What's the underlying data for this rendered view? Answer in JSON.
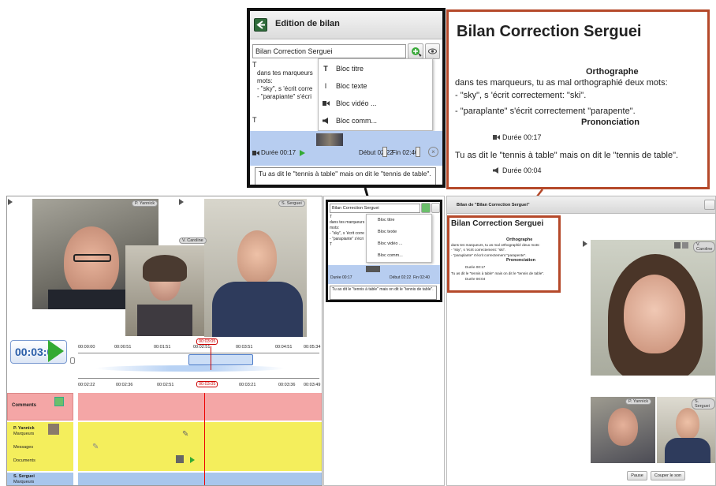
{
  "editor_zoom": {
    "header_title": "Edition de bilan",
    "title_input_value": "Bilan Correction Serguei",
    "menu_items": [
      {
        "icon": "T",
        "label": "Bloc titre"
      },
      {
        "icon": "I",
        "label": "Bloc texte"
      },
      {
        "icon": "video-icon",
        "label": "Bloc vidéo ..."
      },
      {
        "icon": "speaker-icon",
        "label": "Bloc comm..."
      }
    ],
    "block_T1": "T",
    "text_block_lines": [
      "dans tes marqueurs",
      "mots:",
      "- \"sky\", s 'écrit corre",
      "- \"parapiante\" s'écri"
    ],
    "block_T2": "T",
    "duration_label": "Durée 00:17",
    "debut_label": "Début 02:22",
    "fin_label": "Fin 02:40",
    "comment_text": "Tu as dit le \"tennis à table\" mais on dit le \"tennis de table\"."
  },
  "report_zoom": {
    "title": "Bilan Correction Serguei",
    "heading_ortho": "Orthographe",
    "line1": "dans tes marqueurs, tu as mal orthographié deux mots:",
    "line2": "- \"sky\", s 'écrit correctement: \"ski\".",
    "line3": "- \"paraplante\" s'écrit correctement \"parapente\".",
    "heading_prono": "Prononciation",
    "duration1": "Durée 00:17",
    "line4": "Tu as dit le \"tennis à table\" mais on dit le \"tennis de table\".",
    "duration2": "Durée 00:04"
  },
  "left_app": {
    "participants": {
      "p1": "P. Yannick",
      "p2": "S. Serguei",
      "p3": "V. Caroline"
    },
    "timer": "00:03:05",
    "timeline1_ticks": [
      "00:00:00",
      "00:00:51",
      "00:01:51",
      "00:02:51",
      "00:03:51",
      "00:04:51",
      "00:05:34"
    ],
    "timeline1_marker": "00:03:05",
    "timeline2_ticks": [
      "00:02:22",
      "00:02:36",
      "00:02:51",
      "00:03:05",
      "00:03:21",
      "00:03:36",
      "00:03:49"
    ],
    "timeline2_marker": "00:03:05",
    "comments_label": "Comments",
    "track1": {
      "name": "P. Yannick",
      "marqueurs": "Marqueurs",
      "messages": "Messages",
      "documents": "Documents"
    },
    "track2": {
      "name": "S. Serguei",
      "marqueurs": "Marqueurs"
    }
  },
  "mid_small": {
    "title_input_value": "Bilan Correction Serguei",
    "menu_items": [
      "Bloc titre",
      "Bloc texte",
      "Bloc vidéo ...",
      "Bloc comm..."
    ],
    "block_lines": [
      "T",
      "dans tes marqueurs",
      "mots:",
      "- \"sky\", s 'écrit corre",
      "- \"parapiante\" s'écri",
      "T"
    ],
    "duration_label": "Durée 00:17",
    "debut_label": "Début 02:22",
    "fin_label": "Fin 02:40",
    "comment_text": "Tu as dit le \"tennis à table\" mais on dit le \"tennis de table\"."
  },
  "right_app": {
    "window_title": "Bilan de \"Bilan Correction Serguei\"",
    "report_title": "Bilan Correction Serguei",
    "heading_ortho": "Orthographe",
    "line1": "dans tes marqueurs, tu as mal orthographié deux mots:",
    "line2": "- \"sky\", s 'écrit correctement: \"ski\".",
    "line3": "- \"paraplante\" s'écrit correctement \"parapente\".",
    "heading_prono": "Prononciation",
    "duration1": "Durée 00:17",
    "line4": "Tu as dit le \"tennis à table\" mais on dit le \"tennis de table\".",
    "duration2": "Durée 00:04",
    "big_video_name": "V. Caroline",
    "thumb1_name": "P. Yannick",
    "thumb2_name": "S. Serguei",
    "pause_label": "Pause",
    "mute_label": "Couper le son"
  },
  "colors": {
    "accent_red": "#c0392b",
    "comments_bg": "#f4a6a6",
    "track_yellow": "#f4ee5c",
    "track_blue": "#a8c6ec",
    "timer_blue": "#2a5ea8",
    "play_green": "#33aa33"
  }
}
